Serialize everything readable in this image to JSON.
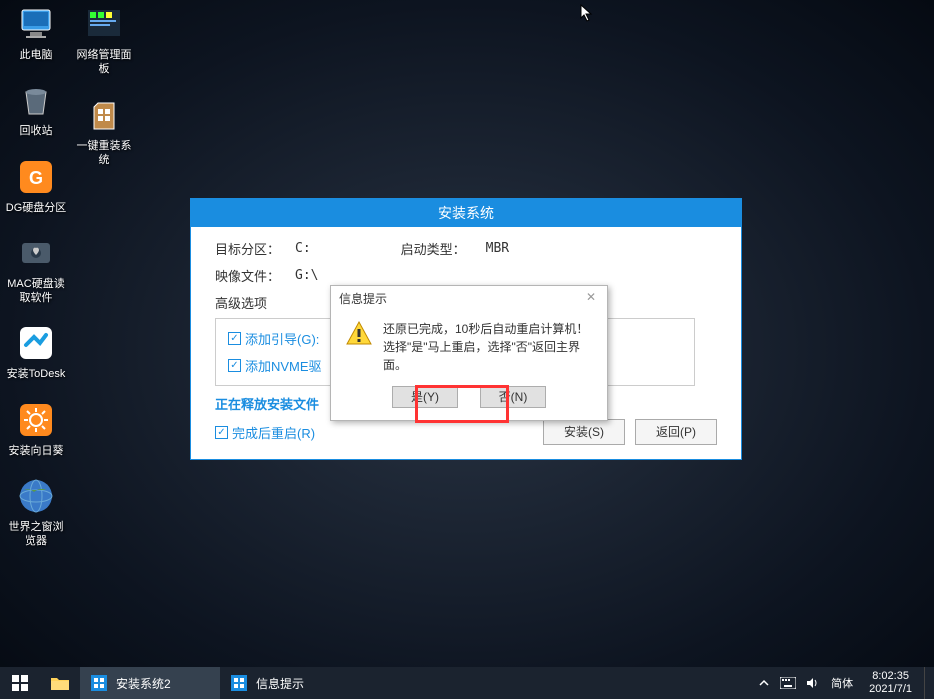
{
  "desktop": {
    "col1": [
      {
        "label": "此电脑",
        "icon": "monitor"
      },
      {
        "label": "回收站",
        "icon": "trash"
      },
      {
        "label": "DG硬盘分区",
        "icon": "dg"
      },
      {
        "label": "MAC硬盘读取软件",
        "icon": "mac-disk"
      },
      {
        "label": "安装ToDesk",
        "icon": "todesk"
      },
      {
        "label": "安装向日葵",
        "icon": "sunflower"
      },
      {
        "label": "世界之窗浏览器",
        "icon": "globe"
      }
    ],
    "col2": [
      {
        "label": "网络管理面板",
        "icon": "net-panel"
      },
      {
        "label": "一键重装系统",
        "icon": "reinstall"
      }
    ]
  },
  "install": {
    "title": "安装系统",
    "target_label": "目标分区：",
    "target_value": "C:",
    "boot_label": "启动类型：",
    "boot_value": "MBR",
    "image_label": "映像文件：",
    "image_value": "G:\\",
    "advanced_title": "高级选项",
    "chk_boot": "添加引导(G):",
    "chk_nvme": "添加NVME驱",
    "status": "正在释放安装文件",
    "chk_restart": "完成后重启(R)",
    "btn_install": "安装(S)",
    "btn_back": "返回(P)"
  },
  "dialog": {
    "title": "信息提示",
    "line1": "还原已完成，10秒后自动重启计算机！",
    "line2": "选择\"是\"马上重启，选择\"否\"返回主界面。",
    "btn_yes": "是(Y)",
    "btn_no": "否(N)"
  },
  "taskbar": {
    "task1": "安装系统2",
    "task2": "信息提示",
    "ime": "简体",
    "time": "8:02:35",
    "date": "2021/7/1"
  }
}
